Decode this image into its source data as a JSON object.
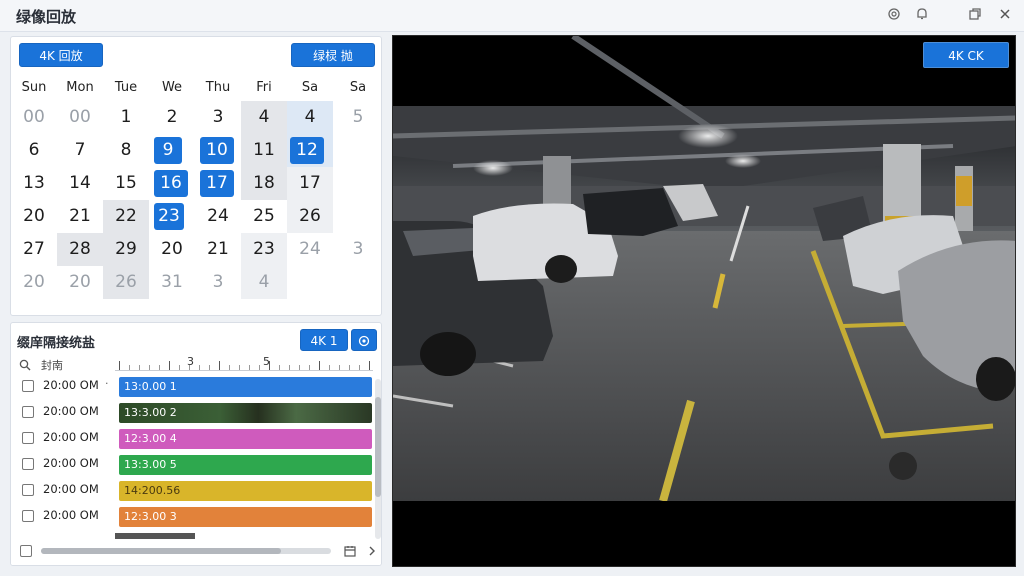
{
  "window": {
    "title": "绿像回放"
  },
  "titlebar_icons": [
    "settings-icon",
    "bell-icon",
    "restore-icon",
    "close-icon"
  ],
  "calendar": {
    "left_button": "4K 回放",
    "right_button": "绿棂 抛",
    "weekdays": [
      "Sun",
      "Mon",
      "Tue",
      "We",
      "Thu",
      "Fri",
      "Sa",
      "Sa"
    ],
    "rows": [
      [
        "00",
        "00",
        "1",
        "2",
        "3",
        "4",
        "4",
        "5"
      ],
      [
        "6",
        "7",
        "8",
        "9",
        "10",
        "11",
        "12",
        ""
      ],
      [
        "13",
        "14",
        "15",
        "16",
        "17",
        "18",
        "17",
        ""
      ],
      [
        "20",
        "21",
        "22",
        "23",
        "24",
        "25",
        "26",
        ""
      ],
      [
        "27",
        "28",
        "29",
        "20",
        "21",
        "23",
        "24",
        "3"
      ],
      [
        "20",
        "20",
        "26",
        "31",
        "3",
        "4",
        "",
        ""
      ]
    ]
  },
  "recordings": {
    "title": "缀庠隔接统盐",
    "btn_label": "4K 1",
    "column_header": "封南",
    "ruler_labels": [
      "3",
      "5"
    ],
    "rows": [
      {
        "time": "20:00 OM",
        "mark": "·",
        "label": "13:0.00 1",
        "color": "#2a7bdc"
      },
      {
        "time": "20:00 OM",
        "mark": "",
        "label": "13:3.00 2",
        "color": "#35552e"
      },
      {
        "time": "20:00 OM",
        "mark": "",
        "label": "12:3.00 4",
        "color": "#cf5bbd"
      },
      {
        "time": "20:00 OM",
        "mark": "",
        "label": "13:3.00 5",
        "color": "#2ea84e"
      },
      {
        "time": "20:00 OM",
        "mark": "",
        "label": "14:200.56",
        "color": "#d9b52a"
      },
      {
        "time": "20:00 OM",
        "mark": "",
        "label": "12:3.00 3",
        "color": "#e2823a"
      }
    ]
  },
  "video": {
    "ok_button": "4K CK"
  }
}
